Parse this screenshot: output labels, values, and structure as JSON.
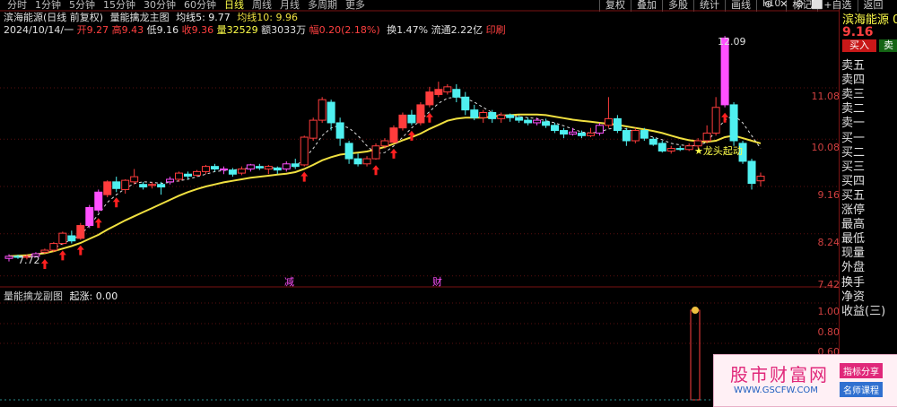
{
  "toolbar": {
    "periods": [
      "分时",
      "1分钟",
      "5分钟",
      "15分钟",
      "30分钟",
      "60分钟",
      "日线",
      "周线",
      "月线",
      "多周期",
      "更多"
    ],
    "active_period": "日线",
    "right_buttons": [
      "复权",
      "叠加",
      "多股",
      "统计",
      "画线",
      "F10",
      "标记",
      "+自选",
      "返回"
    ],
    "window_buttons": [
      "⊕",
      "✕",
      "⚙",
      "⬜"
    ]
  },
  "header": {
    "stock_title": "滨海能源(日线 前复权)",
    "indicator": "量能擒龙主图",
    "ma5": "均线5: 9.77",
    "ma10": "均线10: 9.96",
    "date": "2024/10/14/一",
    "open": "开9.27",
    "high": "高9.43",
    "low": "低9.16",
    "close": "收9.36",
    "volume": "量32529",
    "amount": "额3033万",
    "change": "幅0.20(2.18%)",
    "turnover": "换1.47%",
    "float": "流通2.22亿",
    "print": "印刷"
  },
  "price_axis": [
    "11.08",
    "10.08",
    "9.16",
    "8.24",
    "7.42"
  ],
  "annotations": {
    "high_label": "12.09",
    "low_label": "7.72",
    "star_label": "★龙头起动",
    "marker_reduce": "减",
    "marker_finance": "财"
  },
  "sub_chart": {
    "title": "量能擒龙副图",
    "value": "起涨: 0.00",
    "axis": [
      "1.00",
      "0.80",
      "0.60"
    ]
  },
  "side_panel": {
    "stock_name": "滨海能源 0",
    "price": "9.16",
    "buy_label": "买入",
    "sell_label": "卖",
    "labels": [
      "卖五",
      "卖四",
      "卖三",
      "卖二",
      "卖一",
      "买一",
      "买二",
      "买三",
      "买四",
      "买五",
      "涨停",
      "最高",
      "最低",
      "现量",
      "外盘",
      "换手",
      "净资",
      "收益(三)"
    ]
  },
  "watermark": {
    "title": "股市财富网",
    "url": "WWW.GSCFW.COM",
    "tag1": "指标分享",
    "tag2": "名师课程"
  },
  "colors": {
    "up": "#ff3c3c",
    "down": "#4ff0f0",
    "ma_main": "#f0e040",
    "ma_dash": "#e0e0e0",
    "magenta": "#ff50ff",
    "axis_red": "#d04040"
  },
  "candles": [
    {
      "o": 7.76,
      "c": 7.8,
      "h": 7.84,
      "l": 7.7
    },
    {
      "o": 7.8,
      "c": 7.78,
      "h": 7.83,
      "l": 7.75
    },
    {
      "o": 7.78,
      "c": 7.8,
      "h": 7.84,
      "l": 7.74
    },
    {
      "o": 7.8,
      "c": 7.85,
      "h": 7.88,
      "l": 7.78
    },
    {
      "o": 7.88,
      "c": 7.92,
      "h": 7.95,
      "l": 7.85
    },
    {
      "o": 7.92,
      "c": 8.05,
      "h": 8.08,
      "l": 7.88
    },
    {
      "o": 8.05,
      "c": 8.25,
      "h": 8.28,
      "l": 8.02
    },
    {
      "o": 8.2,
      "c": 8.1,
      "h": 8.3,
      "l": 8.05
    },
    {
      "o": 8.15,
      "c": 8.4,
      "h": 8.45,
      "l": 8.12
    },
    {
      "o": 8.4,
      "c": 8.75,
      "h": 8.8,
      "l": 8.35
    },
    {
      "o": 8.7,
      "c": 9.05,
      "h": 9.1,
      "l": 8.65
    },
    {
      "o": 9.0,
      "c": 9.25,
      "h": 9.28,
      "l": 8.95
    },
    {
      "o": 9.25,
      "c": 9.12,
      "h": 9.35,
      "l": 9.05
    },
    {
      "o": 9.1,
      "c": 9.28,
      "h": 9.3,
      "l": 9.02
    },
    {
      "o": 9.25,
      "c": 9.35,
      "h": 9.5,
      "l": 9.2
    },
    {
      "o": 9.2,
      "c": 9.15,
      "h": 9.25,
      "l": 9.1
    },
    {
      "o": 9.18,
      "c": 9.2,
      "h": 9.24,
      "l": 9.12
    },
    {
      "o": 9.2,
      "c": 9.15,
      "h": 9.25,
      "l": 9.0
    },
    {
      "o": 9.25,
      "c": 9.3,
      "h": 9.35,
      "l": 9.2
    },
    {
      "o": 9.3,
      "c": 9.42,
      "h": 9.45,
      "l": 9.25
    },
    {
      "o": 9.4,
      "c": 9.36,
      "h": 9.45,
      "l": 9.3
    },
    {
      "o": 9.38,
      "c": 9.45,
      "h": 9.48,
      "l": 9.35
    },
    {
      "o": 9.45,
      "c": 9.55,
      "h": 9.58,
      "l": 9.4
    },
    {
      "o": 9.55,
      "c": 9.5,
      "h": 9.6,
      "l": 9.45
    },
    {
      "o": 9.48,
      "c": 9.5,
      "h": 9.55,
      "l": 9.4
    },
    {
      "o": 9.48,
      "c": 9.4,
      "h": 9.52,
      "l": 9.35
    },
    {
      "o": 9.42,
      "c": 9.5,
      "h": 9.55,
      "l": 9.38
    },
    {
      "o": 9.5,
      "c": 9.58,
      "h": 9.6,
      "l": 9.45
    },
    {
      "o": 9.55,
      "c": 9.52,
      "h": 9.6,
      "l": 9.48
    },
    {
      "o": 9.5,
      "c": 9.55,
      "h": 9.58,
      "l": 9.4
    },
    {
      "o": 9.52,
      "c": 9.48,
      "h": 9.55,
      "l": 9.4
    },
    {
      "o": 9.5,
      "c": 9.6,
      "h": 9.65,
      "l": 9.45
    },
    {
      "o": 9.6,
      "c": 9.55,
      "h": 9.7,
      "l": 9.5
    },
    {
      "o": 9.58,
      "c": 10.12,
      "h": 10.15,
      "l": 9.55
    },
    {
      "o": 10.1,
      "c": 10.45,
      "h": 10.5,
      "l": 10.05
    },
    {
      "o": 10.45,
      "c": 10.85,
      "h": 10.9,
      "l": 10.4
    },
    {
      "o": 10.8,
      "c": 10.4,
      "h": 10.85,
      "l": 10.25
    },
    {
      "o": 10.4,
      "c": 10.1,
      "h": 10.5,
      "l": 9.95
    },
    {
      "o": 10.0,
      "c": 9.7,
      "h": 10.05,
      "l": 9.6
    },
    {
      "o": 9.7,
      "c": 9.6,
      "h": 9.8,
      "l": 9.55
    },
    {
      "o": 9.6,
      "c": 9.7,
      "h": 9.75,
      "l": 9.55
    },
    {
      "o": 9.7,
      "c": 9.95,
      "h": 10.0,
      "l": 9.68
    },
    {
      "o": 9.95,
      "c": 10.05,
      "h": 10.1,
      "l": 9.9
    },
    {
      "o": 10.02,
      "c": 10.3,
      "h": 10.35,
      "l": 10.0
    },
    {
      "o": 10.3,
      "c": 10.55,
      "h": 10.6,
      "l": 10.25
    },
    {
      "o": 10.55,
      "c": 10.4,
      "h": 10.65,
      "l": 10.35
    },
    {
      "o": 10.4,
      "c": 10.75,
      "h": 10.8,
      "l": 10.35
    },
    {
      "o": 10.75,
      "c": 11.0,
      "h": 11.1,
      "l": 10.7
    },
    {
      "o": 10.95,
      "c": 11.05,
      "h": 11.2,
      "l": 10.9
    },
    {
      "o": 11.0,
      "c": 11.1,
      "h": 11.15,
      "l": 10.95
    },
    {
      "o": 11.05,
      "c": 10.9,
      "h": 11.15,
      "l": 10.8
    },
    {
      "o": 10.9,
      "c": 10.65,
      "h": 11.0,
      "l": 10.55
    },
    {
      "o": 10.65,
      "c": 10.5,
      "h": 10.75,
      "l": 10.45
    },
    {
      "o": 10.5,
      "c": 10.6,
      "h": 10.65,
      "l": 10.4
    },
    {
      "o": 10.6,
      "c": 10.48,
      "h": 10.65,
      "l": 10.4
    },
    {
      "o": 10.48,
      "c": 10.55,
      "h": 10.6,
      "l": 10.4
    },
    {
      "o": 10.55,
      "c": 10.5,
      "h": 10.58,
      "l": 10.42
    },
    {
      "o": 10.5,
      "c": 10.45,
      "h": 10.55,
      "l": 10.4
    },
    {
      "o": 10.45,
      "c": 10.4,
      "h": 10.5,
      "l": 10.35
    },
    {
      "o": 10.4,
      "c": 10.45,
      "h": 10.5,
      "l": 10.35
    },
    {
      "o": 10.42,
      "c": 10.35,
      "h": 10.48,
      "l": 10.3
    },
    {
      "o": 10.35,
      "c": 10.25,
      "h": 10.4,
      "l": 10.2
    },
    {
      "o": 10.25,
      "c": 10.18,
      "h": 10.3,
      "l": 10.1
    },
    {
      "o": 10.18,
      "c": 10.22,
      "h": 10.3,
      "l": 10.15
    },
    {
      "o": 10.2,
      "c": 10.15,
      "h": 10.25,
      "l": 10.1
    },
    {
      "o": 10.15,
      "c": 10.2,
      "h": 10.3,
      "l": 10.12
    },
    {
      "o": 10.2,
      "c": 10.35,
      "h": 10.4,
      "l": 10.15
    },
    {
      "o": 10.35,
      "c": 10.48,
      "h": 10.9,
      "l": 10.3
    },
    {
      "o": 10.48,
      "c": 10.25,
      "h": 10.55,
      "l": 10.2
    },
    {
      "o": 10.25,
      "c": 10.05,
      "h": 10.3,
      "l": 9.95
    },
    {
      "o": 10.05,
      "c": 10.25,
      "h": 10.3,
      "l": 10.0
    },
    {
      "o": 10.25,
      "c": 10.1,
      "h": 10.3,
      "l": 10.05
    },
    {
      "o": 10.08,
      "c": 9.98,
      "h": 10.12,
      "l": 9.95
    },
    {
      "o": 10.0,
      "c": 9.85,
      "h": 10.05,
      "l": 9.82
    },
    {
      "o": 9.85,
      "c": 9.9,
      "h": 9.95,
      "l": 9.8
    },
    {
      "o": 9.9,
      "c": 9.88,
      "h": 9.95,
      "l": 9.85
    },
    {
      "o": 9.88,
      "c": 9.95,
      "h": 10.0,
      "l": 9.85
    },
    {
      "o": 9.95,
      "c": 10.05,
      "h": 10.1,
      "l": 9.9
    },
    {
      "o": 10.05,
      "c": 10.2,
      "h": 10.35,
      "l": 10.0
    },
    {
      "o": 10.2,
      "c": 10.7,
      "h": 10.9,
      "l": 10.15
    },
    {
      "o": 10.75,
      "c": 12.05,
      "h": 12.09,
      "l": 10.7
    },
    {
      "o": 10.75,
      "c": 10.05,
      "h": 10.8,
      "l": 9.95
    },
    {
      "o": 10.0,
      "c": 9.65,
      "h": 10.05,
      "l": 9.6
    },
    {
      "o": 9.65,
      "c": 9.22,
      "h": 9.7,
      "l": 9.1
    },
    {
      "o": 9.27,
      "c": 9.36,
      "h": 9.43,
      "l": 9.16
    }
  ],
  "ma_line": [
    7.8,
    7.81,
    7.82,
    7.84,
    7.86,
    7.9,
    7.95,
    8.0,
    8.06,
    8.14,
    8.22,
    8.32,
    8.41,
    8.5,
    8.58,
    8.66,
    8.74,
    8.82,
    8.9,
    8.98,
    9.05,
    9.11,
    9.16,
    9.2,
    9.24,
    9.27,
    9.3,
    9.33,
    9.35,
    9.37,
    9.39,
    9.41,
    9.44,
    9.5,
    9.58,
    9.67,
    9.73,
    9.78,
    9.8,
    9.82,
    9.84,
    9.88,
    9.93,
    9.99,
    10.06,
    10.12,
    10.19,
    10.28,
    10.36,
    10.44,
    10.48,
    10.5,
    10.5,
    10.5,
    10.52,
    10.54,
    10.55,
    10.56,
    10.56,
    10.56,
    10.55,
    10.52,
    10.49,
    10.46,
    10.44,
    10.42,
    10.4,
    10.38,
    10.36,
    10.33,
    10.3,
    10.27,
    10.24,
    10.2,
    10.15,
    10.1,
    10.06,
    10.04,
    10.03,
    10.05,
    10.12,
    10.15,
    10.1,
    10.05,
    10.0
  ],
  "ma_short": [
    7.79,
    7.8,
    7.81,
    7.84,
    7.88,
    7.95,
    8.05,
    8.12,
    8.22,
    8.4,
    8.62,
    8.85,
    9.0,
    9.12,
    9.22,
    9.25,
    9.24,
    9.22,
    9.24,
    9.27,
    9.3,
    9.35,
    9.4,
    9.45,
    9.47,
    9.48,
    9.5,
    9.52,
    9.53,
    9.53,
    9.52,
    9.53,
    9.55,
    9.7,
    9.9,
    10.15,
    10.3,
    10.35,
    10.3,
    10.15,
    9.95,
    9.8,
    9.82,
    9.95,
    10.12,
    10.3,
    10.45,
    10.62,
    10.78,
    10.88,
    10.9,
    10.88,
    10.8,
    10.7,
    10.6,
    10.55,
    10.53,
    10.52,
    10.5,
    10.48,
    10.44,
    10.4,
    10.34,
    10.28,
    10.22,
    10.2,
    10.22,
    10.28,
    10.3,
    10.28,
    10.22,
    10.17,
    10.12,
    10.07,
    10.0,
    9.97,
    9.95,
    9.96,
    10.02,
    10.25,
    10.45,
    10.55,
    10.4,
    10.15,
    9.9
  ]
}
